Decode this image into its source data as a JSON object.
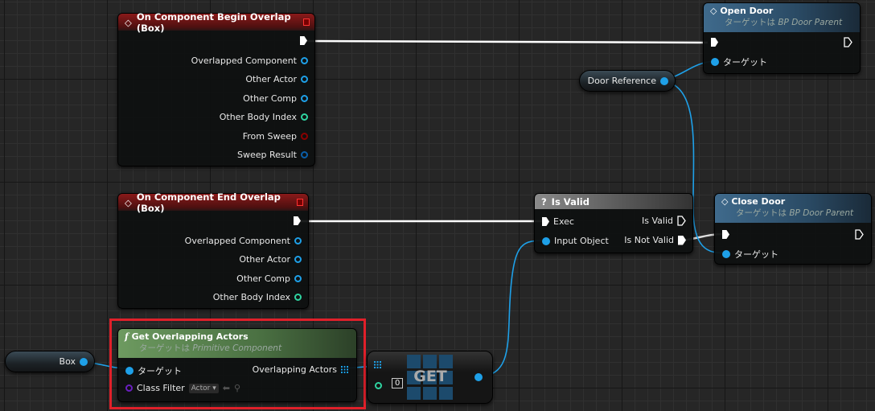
{
  "colors": {
    "object_pin": "#1ea0e8",
    "int_pin": "#2fd3a0",
    "struct_pin": "#0a5ea8",
    "bool_pin": "#8b0000",
    "class_pin": "#6a1fc0",
    "selection": "#e0202a"
  },
  "begin_overlap": {
    "title": "On Component Begin Overlap (Box)",
    "pins": [
      "Overlapped Component",
      "Other Actor",
      "Other Comp",
      "Other Body Index",
      "From Sweep",
      "Sweep Result"
    ]
  },
  "end_overlap": {
    "title": "On Component End Overlap (Box)",
    "pins": [
      "Overlapped Component",
      "Other Actor",
      "Other Comp",
      "Other Body Index"
    ]
  },
  "is_valid": {
    "icon": "question-icon",
    "title": "Is Valid",
    "exec": "Exec",
    "input": "Input Object",
    "out_valid": "Is Valid",
    "out_not_valid": "Is Not Valid"
  },
  "open_door": {
    "title": "Open Door",
    "subtitle_prefix": "ターゲットは",
    "subtitle_class": "BP Door Parent",
    "target": "ターゲット"
  },
  "close_door": {
    "title": "Close Door",
    "subtitle_prefix": "ターゲットは",
    "subtitle_class": "BP Door Parent",
    "target": "ターゲット"
  },
  "door_reference": {
    "label": "Door Reference"
  },
  "box": {
    "label": "Box"
  },
  "get_overlapping": {
    "icon": "f",
    "title": "Get Overlapping Actors",
    "subtitle_prefix": "ターゲットは",
    "subtitle_class": "Primitive Component",
    "target": "ターゲット",
    "output": "Overlapping Actors",
    "class_filter": "Class Filter",
    "class_value": "Actor"
  },
  "get_node": {
    "label": "GET",
    "index": "0"
  }
}
